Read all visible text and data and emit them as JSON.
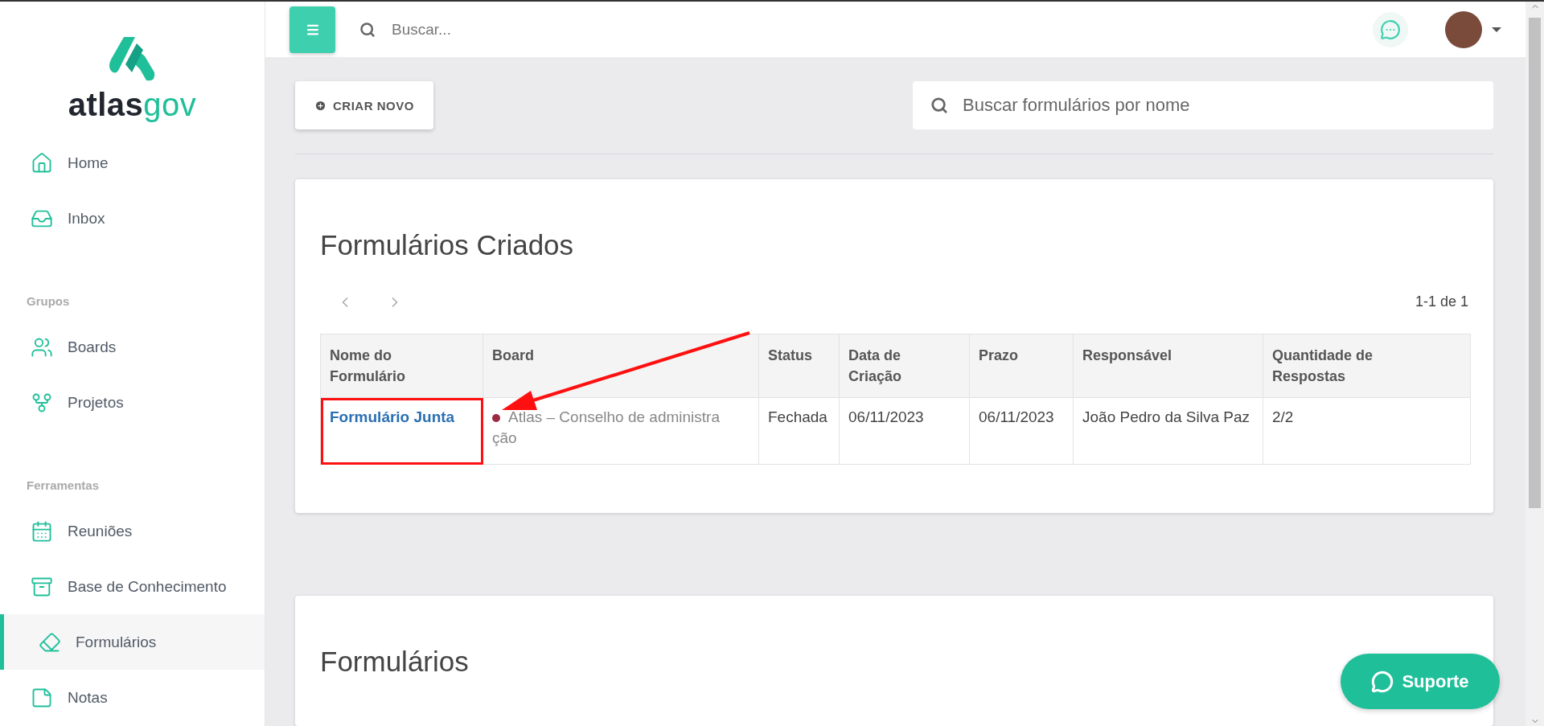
{
  "sidebar": {
    "logo": {
      "dark": "atlas",
      "light": "gov"
    },
    "sections": [
      {
        "items": [
          {
            "label": "Home",
            "selected": false
          },
          {
            "label": "Inbox",
            "selected": false
          }
        ]
      },
      {
        "heading": "Grupos",
        "items": [
          {
            "label": "Boards",
            "selected": false
          },
          {
            "label": "Projetos",
            "selected": false
          }
        ]
      },
      {
        "heading": "Ferramentas",
        "items": [
          {
            "label": "Reuniões",
            "selected": false
          },
          {
            "label": "Base de Conhecimento",
            "selected": false
          },
          {
            "label": "Formulários",
            "selected": true
          },
          {
            "label": "Notas",
            "selected": false
          }
        ]
      }
    ]
  },
  "topbar": {
    "search": {
      "placeholder": "Buscar..."
    }
  },
  "toolbar": {
    "create_button": "CRIAR NOVO",
    "search": {
      "placeholder": "Buscar formulários por nome"
    }
  },
  "created_forms": {
    "title": "Formulários Criados",
    "pagination": "1-1 de 1",
    "columns": [
      "Nome do Formulário",
      "Board",
      "Status",
      "Data de Criação",
      "Prazo",
      "Responsável",
      "Quantidade de Respostas"
    ],
    "rows": [
      {
        "name": "Formulário Junta",
        "board": "Atlas – Conselho de administração",
        "color": "#9b2b3f",
        "status": "Fechada",
        "created": "06/11/2023",
        "deadline": "06/11/2023",
        "owner": "João Pedro da Silva Paz",
        "responses": "2/2",
        "highlighted": true
      }
    ]
  },
  "forms": {
    "title": "Formulários"
  },
  "support_button": "Suporte"
}
